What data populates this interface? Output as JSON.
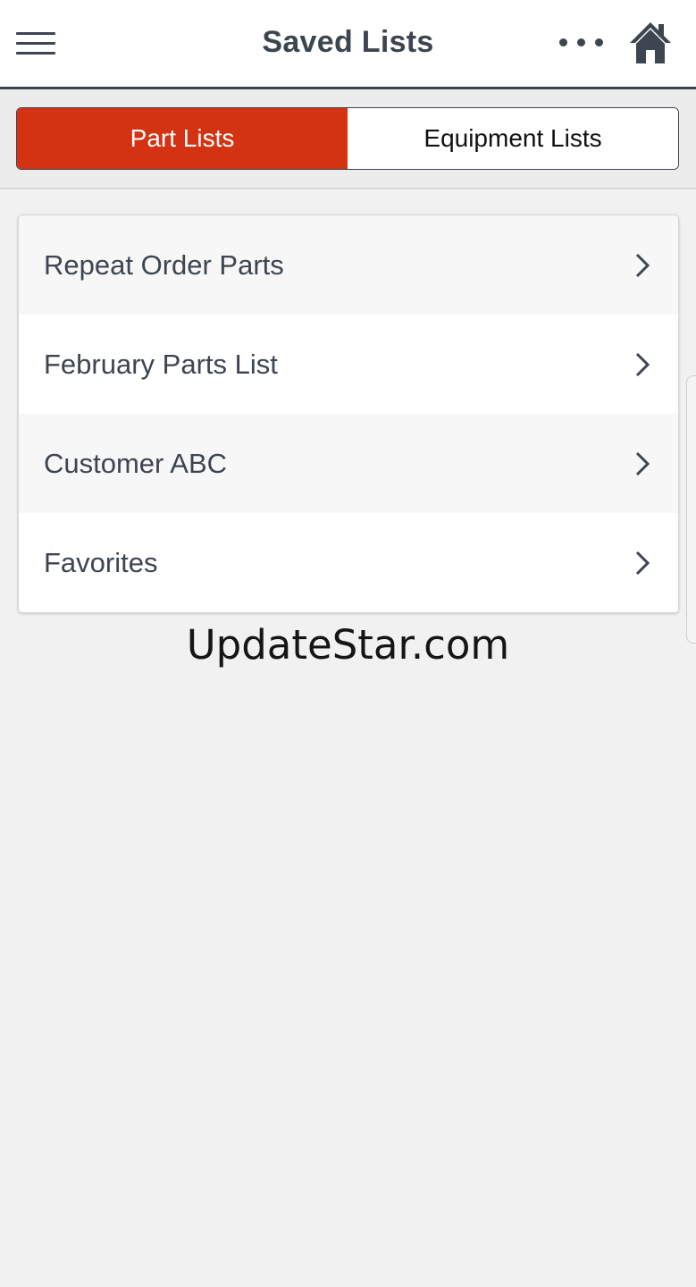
{
  "header": {
    "title": "Saved Lists",
    "menu_icon": "hamburger-menu-icon",
    "more_icon": "more-horizontal-icon",
    "home_icon": "home-icon"
  },
  "tabs": [
    {
      "label": "Part Lists",
      "active": true
    },
    {
      "label": "Equipment Lists",
      "active": false
    }
  ],
  "lists": [
    {
      "label": "Repeat Order Parts"
    },
    {
      "label": "February Parts List"
    },
    {
      "label": "Customer ABC"
    },
    {
      "label": "Favorites"
    }
  ],
  "watermark": "UpdateStar.com",
  "colors": {
    "accent": "#d33213",
    "header_text": "#3d4550",
    "background": "#f1f1f1"
  }
}
